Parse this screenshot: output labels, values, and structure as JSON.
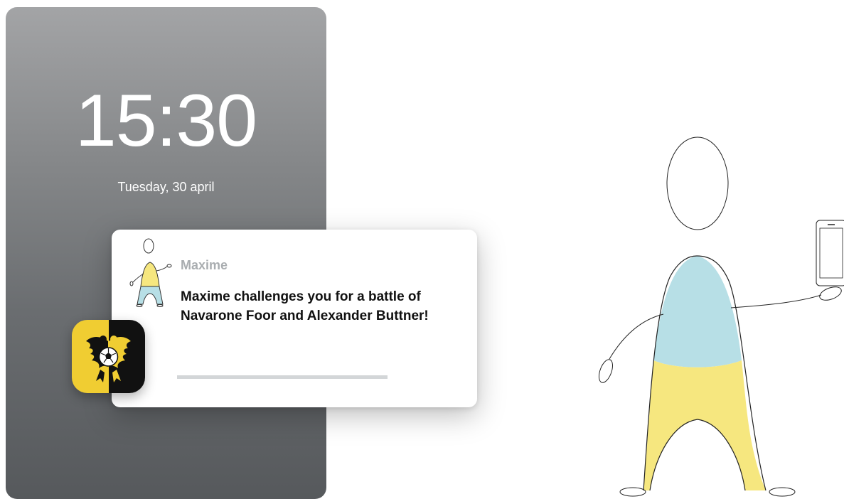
{
  "lock_screen": {
    "time": "15:30",
    "date": "Tuesday, 30 april"
  },
  "notification": {
    "sender": "Maxime",
    "message": "Maxime challenges you for a battle of Navarone Foor and Alexander Buttner!",
    "progress": 1.0,
    "app_icon": "club-crest-icon",
    "avatar": "stick-figure-avatar-icon"
  },
  "illustration": {
    "name": "person-holding-phone",
    "colors": {
      "shirt": "#b7dfe6",
      "pants": "#f6e77f",
      "icon_yellow": "#f0cd32",
      "icon_black": "#111111"
    }
  }
}
